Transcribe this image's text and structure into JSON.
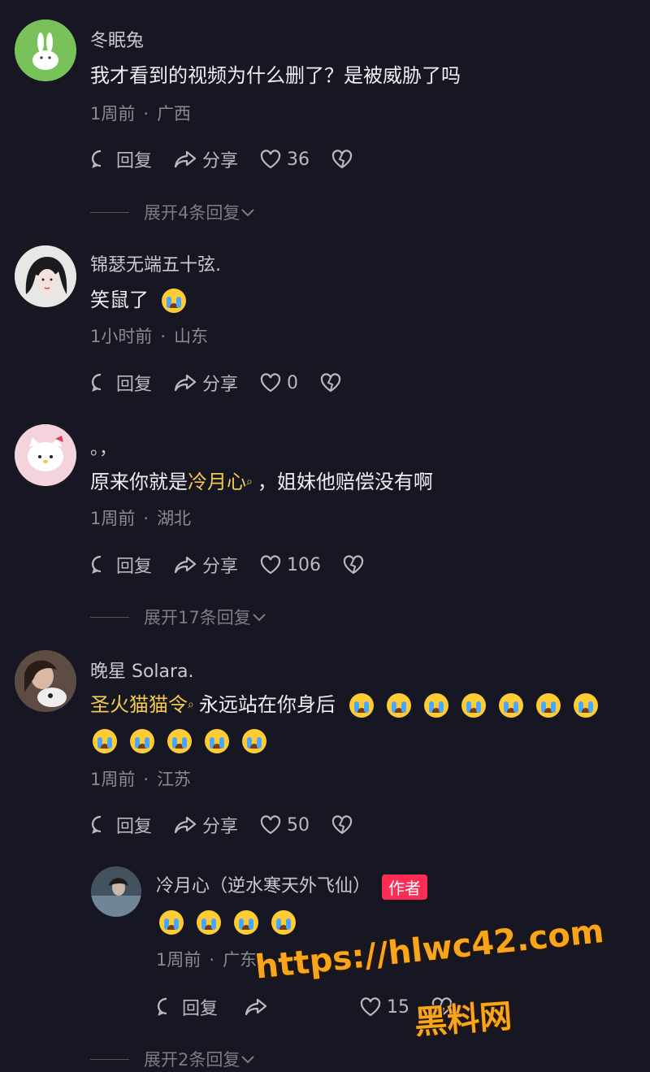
{
  "comments": [
    {
      "username": "冬眠兔",
      "text": "我才看到的视频为什么删了？是被威胁了吗",
      "time": "1周前",
      "location": "广西",
      "reply_label": "回复",
      "share_label": "分享",
      "likes": "36",
      "expand_label": "展开4条回复"
    },
    {
      "username": "锦瑟无端五十弦.",
      "text": "笑鼠了",
      "time": "1小时前",
      "location": "山东",
      "reply_label": "回复",
      "share_label": "分享",
      "likes": "0"
    },
    {
      "username": "。，",
      "text_prefix": "原来你就是",
      "mention": "冷月心",
      "text_suffix": "，姐妹他赔偿没有啊",
      "time": "1周前",
      "location": "湖北",
      "reply_label": "回复",
      "share_label": "分享",
      "likes": "106",
      "expand_label": "展开17条回复"
    },
    {
      "username": "晚星 Solara.",
      "mention": "圣火猫猫令",
      "text_suffix": "永远站在你身后",
      "time": "1周前",
      "location": "江苏",
      "reply_label": "回复",
      "share_label": "分享",
      "likes": "50"
    }
  ],
  "reply": {
    "username": "冷月心（逆水寒天外飞仙）",
    "badge": "作者",
    "time": "1周前",
    "location": "广东",
    "reply_label": "回复",
    "likes": "15",
    "expand_label": "展开2条回复"
  },
  "watermark": {
    "url": "https://hlwc42.com",
    "name": "黑料网"
  },
  "colors": {
    "background": "#161722",
    "mention": "#f2c94c",
    "author_badge": "#fe2c55",
    "watermark": "#f7a51c"
  }
}
